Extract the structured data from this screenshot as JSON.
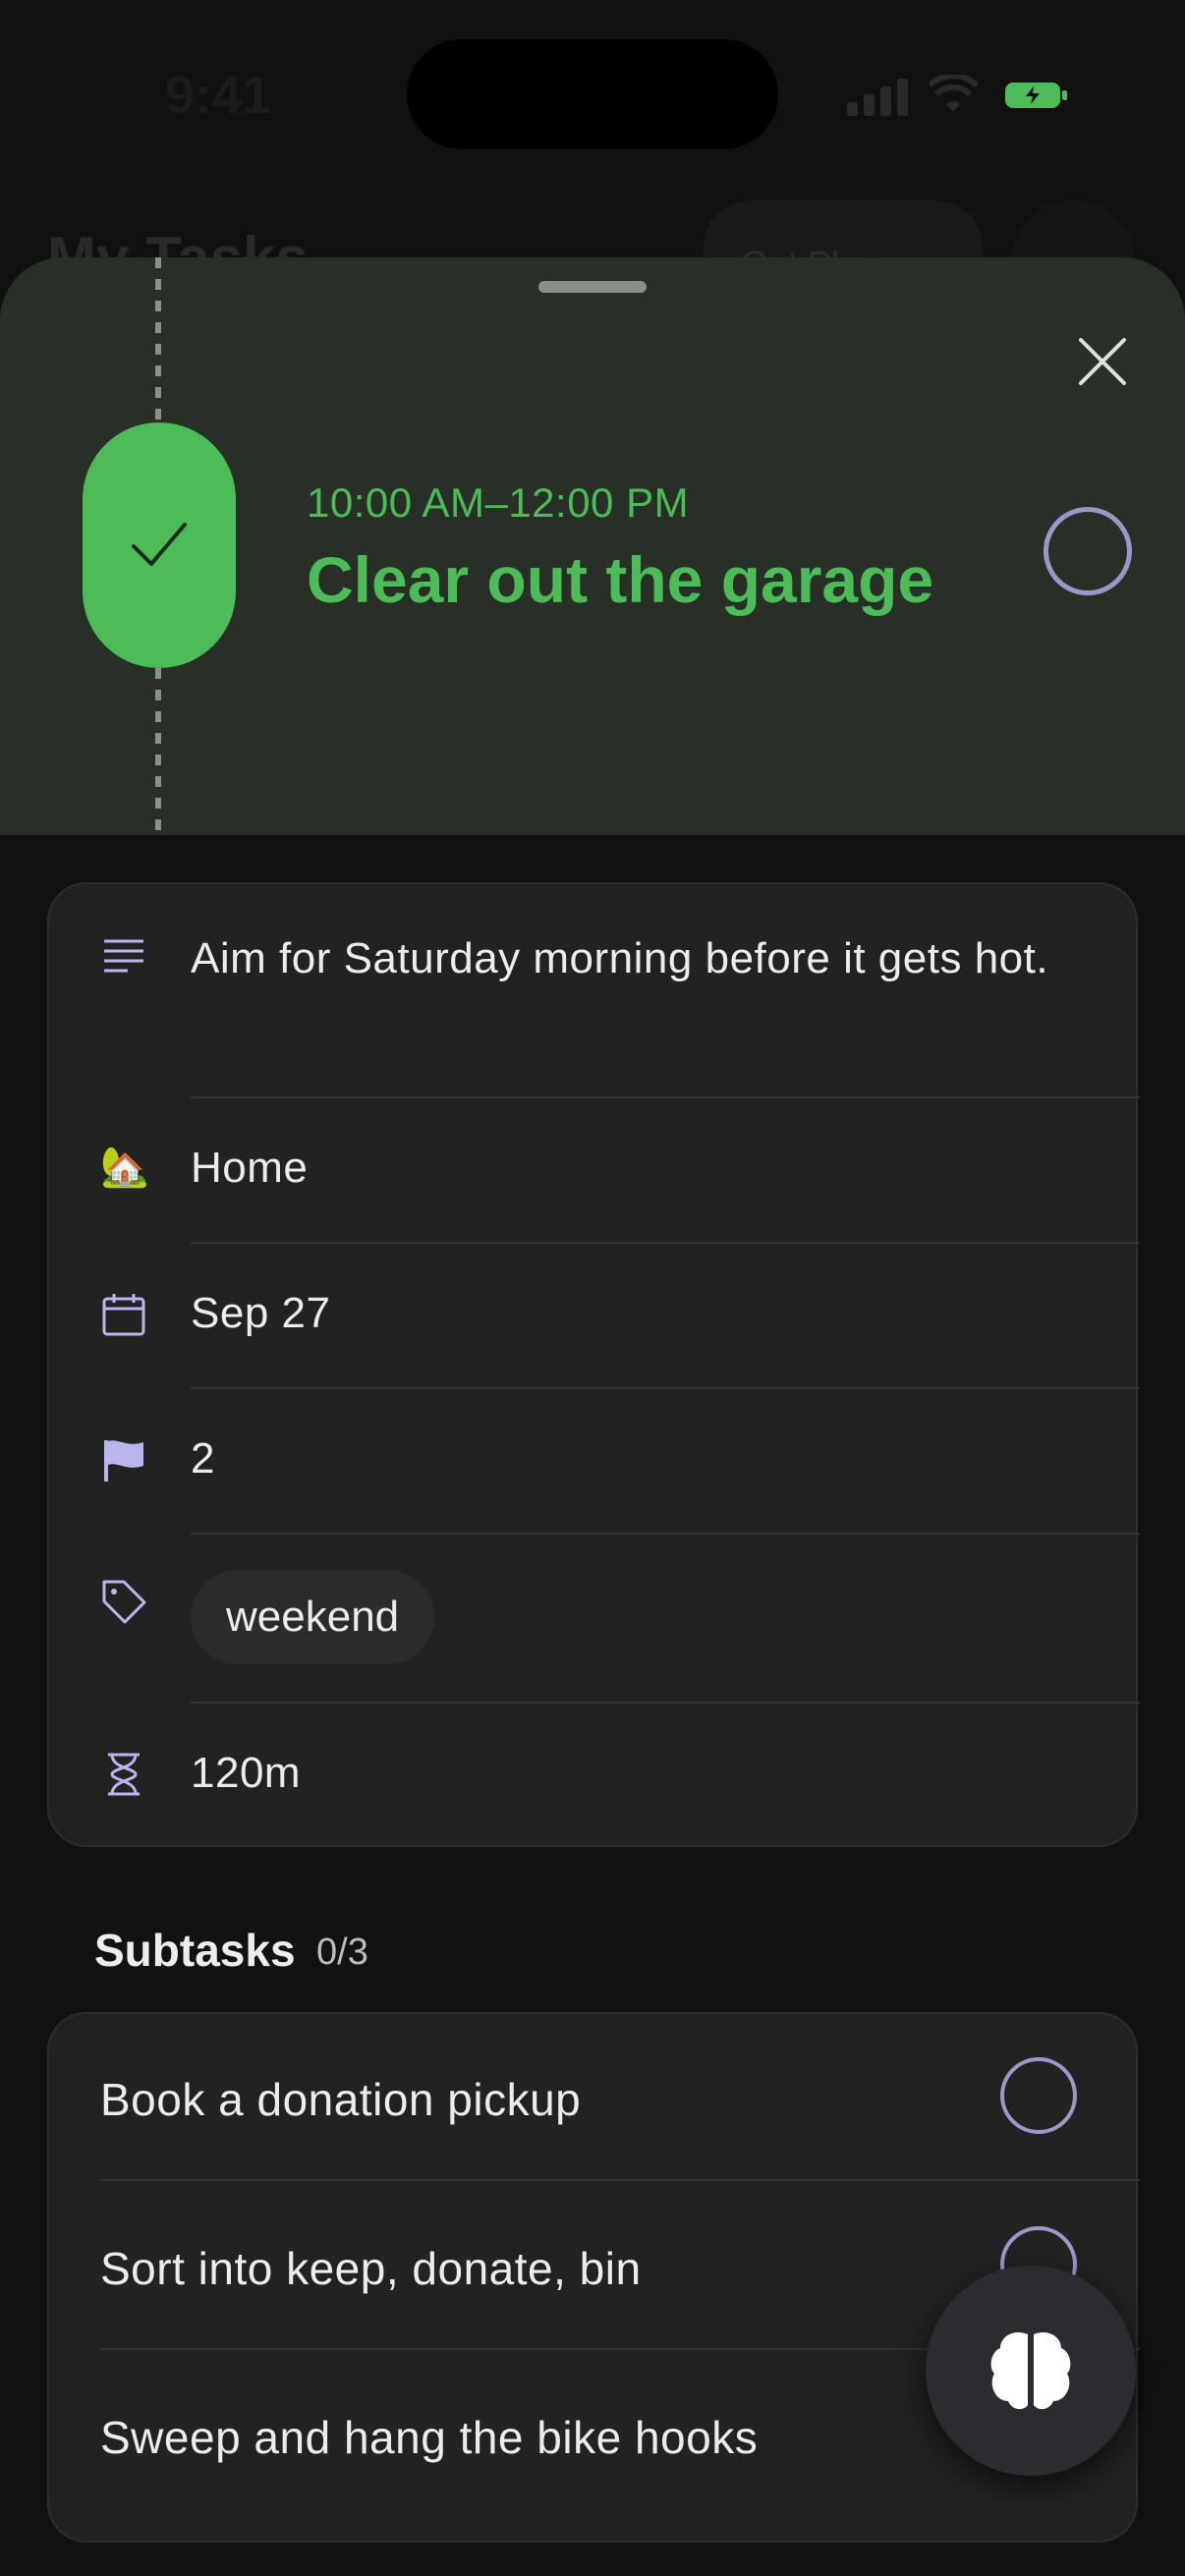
{
  "status_bar": {
    "time": "9:41"
  },
  "background_screen": {
    "title": "My Tasks",
    "pill_label": "Get Plan"
  },
  "task": {
    "time_range": "10:00 AM–12:00 PM",
    "title": "Clear out the garage",
    "accent_color": "#4cbb58"
  },
  "details": {
    "description": "Aim for Saturday morning before it gets hot.",
    "project": "Home",
    "project_emoji": "🏡",
    "date": "Sep 27",
    "priority": "2",
    "tag": "weekend",
    "duration": "120m"
  },
  "subtasks": {
    "title": "Subtasks",
    "count": "0/3",
    "items": [
      {
        "label": "Book a donation pickup"
      },
      {
        "label": "Sort into keep, donate, bin"
      },
      {
        "label": "Sweep and hang the bike hooks"
      }
    ]
  },
  "icons": {
    "close": "close-icon",
    "check": "check-icon",
    "description": "notes-icon",
    "date": "calendar-icon",
    "priority": "flag-icon",
    "tag": "tag-icon",
    "duration": "hourglass-icon",
    "fab": "brain-icon"
  },
  "colors": {
    "sheet_header": "#272f27",
    "circle_outline": "#9a98c9",
    "icon_tint": "#b9b6ee"
  }
}
